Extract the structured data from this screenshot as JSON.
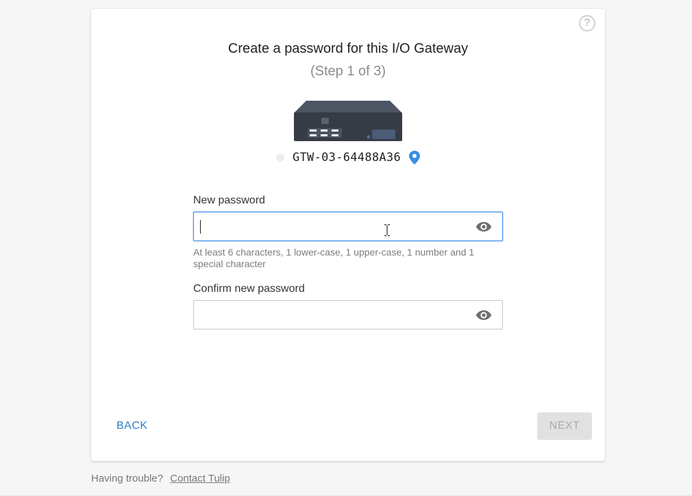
{
  "dialog": {
    "title": "Create a password for this I/O Gateway",
    "step": "(Step 1 of 3)",
    "help_icon": "question-circle-icon",
    "help_glyph": "?"
  },
  "gateway": {
    "name": "GTW-03-64488A36",
    "status_color": "#eeeeee",
    "location_icon": "map-pin-icon",
    "location_color": "#3a8ee6"
  },
  "form": {
    "new_password": {
      "label": "New password",
      "value": "",
      "placeholder": "",
      "toggle_icon": "eye-icon"
    },
    "hint": "At least 6 characters, 1 lower-case, 1 upper-case, 1 number and 1 special character",
    "confirm_password": {
      "label": "Confirm new password",
      "value": "",
      "placeholder": "",
      "toggle_icon": "eye-icon"
    }
  },
  "actions": {
    "back_label": "BACK",
    "next_label": "NEXT"
  },
  "footer": {
    "trouble_text": "Having trouble?",
    "contact_link": "Contact Tulip"
  },
  "colors": {
    "accent": "#2a7fc8",
    "focus": "#3a8ee6",
    "disabled_bg": "#e1e1e1",
    "disabled_text": "#ababab"
  }
}
